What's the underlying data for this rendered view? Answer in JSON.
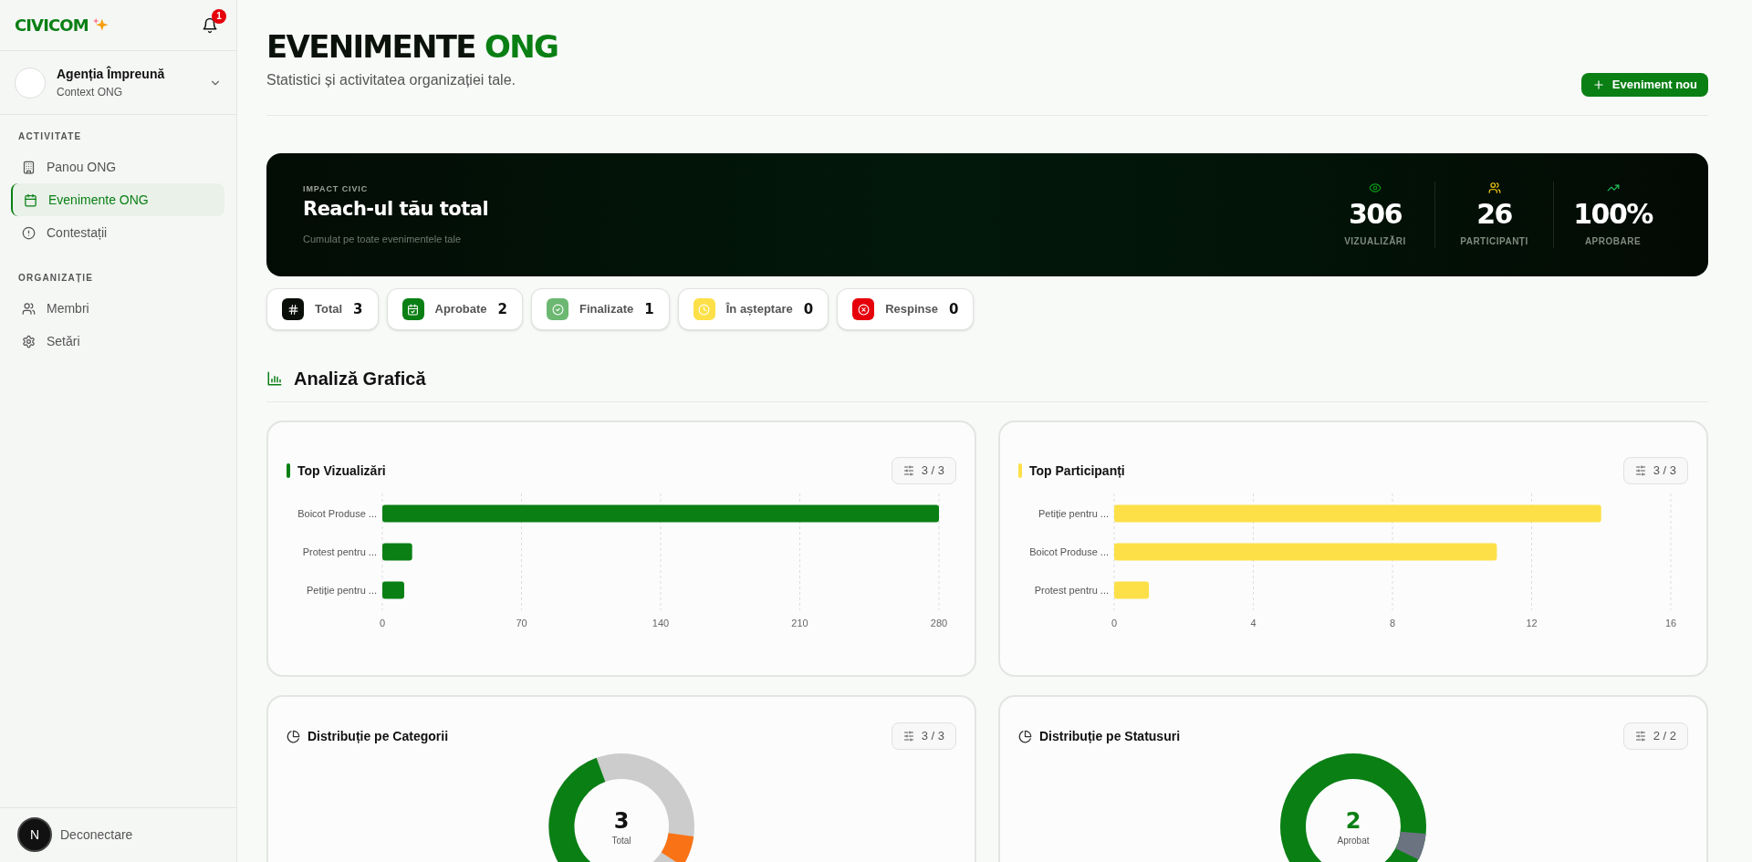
{
  "sidebar": {
    "logo": "CIVICOM",
    "notifications_badge": "1",
    "org": {
      "name": "Agenția Împreună",
      "context": "Context ONG"
    },
    "sections": [
      {
        "title": "ACTIVITATE",
        "items": [
          {
            "label": "Panou ONG",
            "selected": false
          },
          {
            "label": "Evenimente ONG",
            "selected": true
          },
          {
            "label": "Contestații",
            "selected": false
          }
        ]
      },
      {
        "title": "ORGANIZAȚIE",
        "items": [
          {
            "label": "Membri",
            "selected": false
          },
          {
            "label": "Setări",
            "selected": false
          }
        ]
      }
    ],
    "logout": "Deconectare",
    "dev_badge": "N"
  },
  "header": {
    "title": "EVENIMENTE",
    "title_accent": "ONG",
    "subtitle": "Statistici și activitatea organizației tale.",
    "new_button": "Eveniment nou"
  },
  "hero": {
    "eyebrow": "IMPACT CIVIC",
    "title": "Reach-ul tău total",
    "subtitle": "Cumulat pe toate evenimentele tale",
    "stats": [
      {
        "value": "306",
        "label": "VIZUALIZĂRI"
      },
      {
        "value": "26",
        "label": "PARTICIPANȚI"
      },
      {
        "value": "100%",
        "label": "APROBARE"
      }
    ]
  },
  "status_pills": [
    {
      "label": "Total",
      "count": "3",
      "color": "#0a0f0a"
    },
    {
      "label": "Aprobate",
      "count": "2",
      "color": "#0a7f14"
    },
    {
      "label": "Finalizate",
      "count": "1",
      "color": "#6cb872"
    },
    {
      "label": "În așteptare",
      "count": "0",
      "color": "#fde047"
    },
    {
      "label": "Respinse",
      "count": "0",
      "color": "#e5000b"
    }
  ],
  "analysis": {
    "title": "Analiză Grafică",
    "charts": [
      {
        "title": "Top Vizualizări",
        "filter": "3 / 3",
        "chart_data": {
          "type": "bar",
          "orientation": "horizontal",
          "categories": [
            "Boicot Produse ...",
            "Protest pentru ...",
            "Petiție pentru ..."
          ],
          "series": [
            {
              "color": "#0a7f14",
              "values": [
                280,
                15,
                11
              ]
            }
          ],
          "grid": true,
          "xlim": [
            0,
            280
          ],
          "xticks": [
            0,
            70,
            140,
            210,
            280
          ]
        }
      },
      {
        "title": "Top Participanți",
        "filter": "3 / 3",
        "chart_data": {
          "type": "bar",
          "orientation": "horizontal",
          "categories": [
            "Petiție pentru ...",
            "Boicot Produse ...",
            "Protest pentru ..."
          ],
          "series": [
            {
              "color": "#fde047",
              "values": [
                14,
                11,
                1
              ]
            }
          ],
          "grid": true,
          "xlim": [
            0,
            16
          ],
          "xticks": [
            0,
            4,
            8,
            12,
            16
          ]
        }
      }
    ],
    "donuts": [
      {
        "title": "Distribuție pe Categorii",
        "filter": "3 / 3",
        "center_value": "3",
        "center_label": "Total"
      },
      {
        "title": "Distribuție pe Statusuri",
        "filter": "2 / 2",
        "center_value": "2",
        "center_label": "Aprobat"
      }
    ]
  }
}
